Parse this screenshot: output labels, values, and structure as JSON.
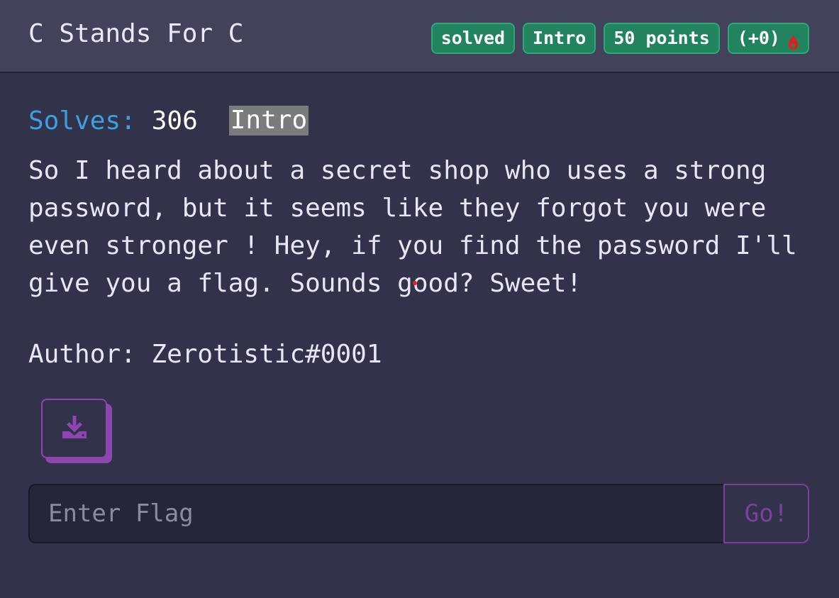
{
  "challenge": {
    "title": "C Stands For C",
    "badges": {
      "status": "solved",
      "category": "Intro",
      "points": "50 points",
      "blood": "(+0)"
    },
    "solves_label": "Solves:",
    "solves_count": "306",
    "tag": "Intro",
    "description": "So I heard about a secret shop who uses a strong\npassword, but it seems like they forgot you were\neven stronger ! Hey, if you find the password I'll\ngive you a flag. Sounds good? Sweet!",
    "author": "Author: Zerotistic#0001"
  },
  "download": {
    "icon": "download-icon"
  },
  "flag_form": {
    "placeholder": "Enter Flag",
    "value": "",
    "submit_label": "Go!"
  },
  "colors": {
    "badge_green": "#22845f",
    "solves_blue": "#3d9fe0",
    "accent_purple": "#8e45b0",
    "blood_red": "#e02020"
  }
}
